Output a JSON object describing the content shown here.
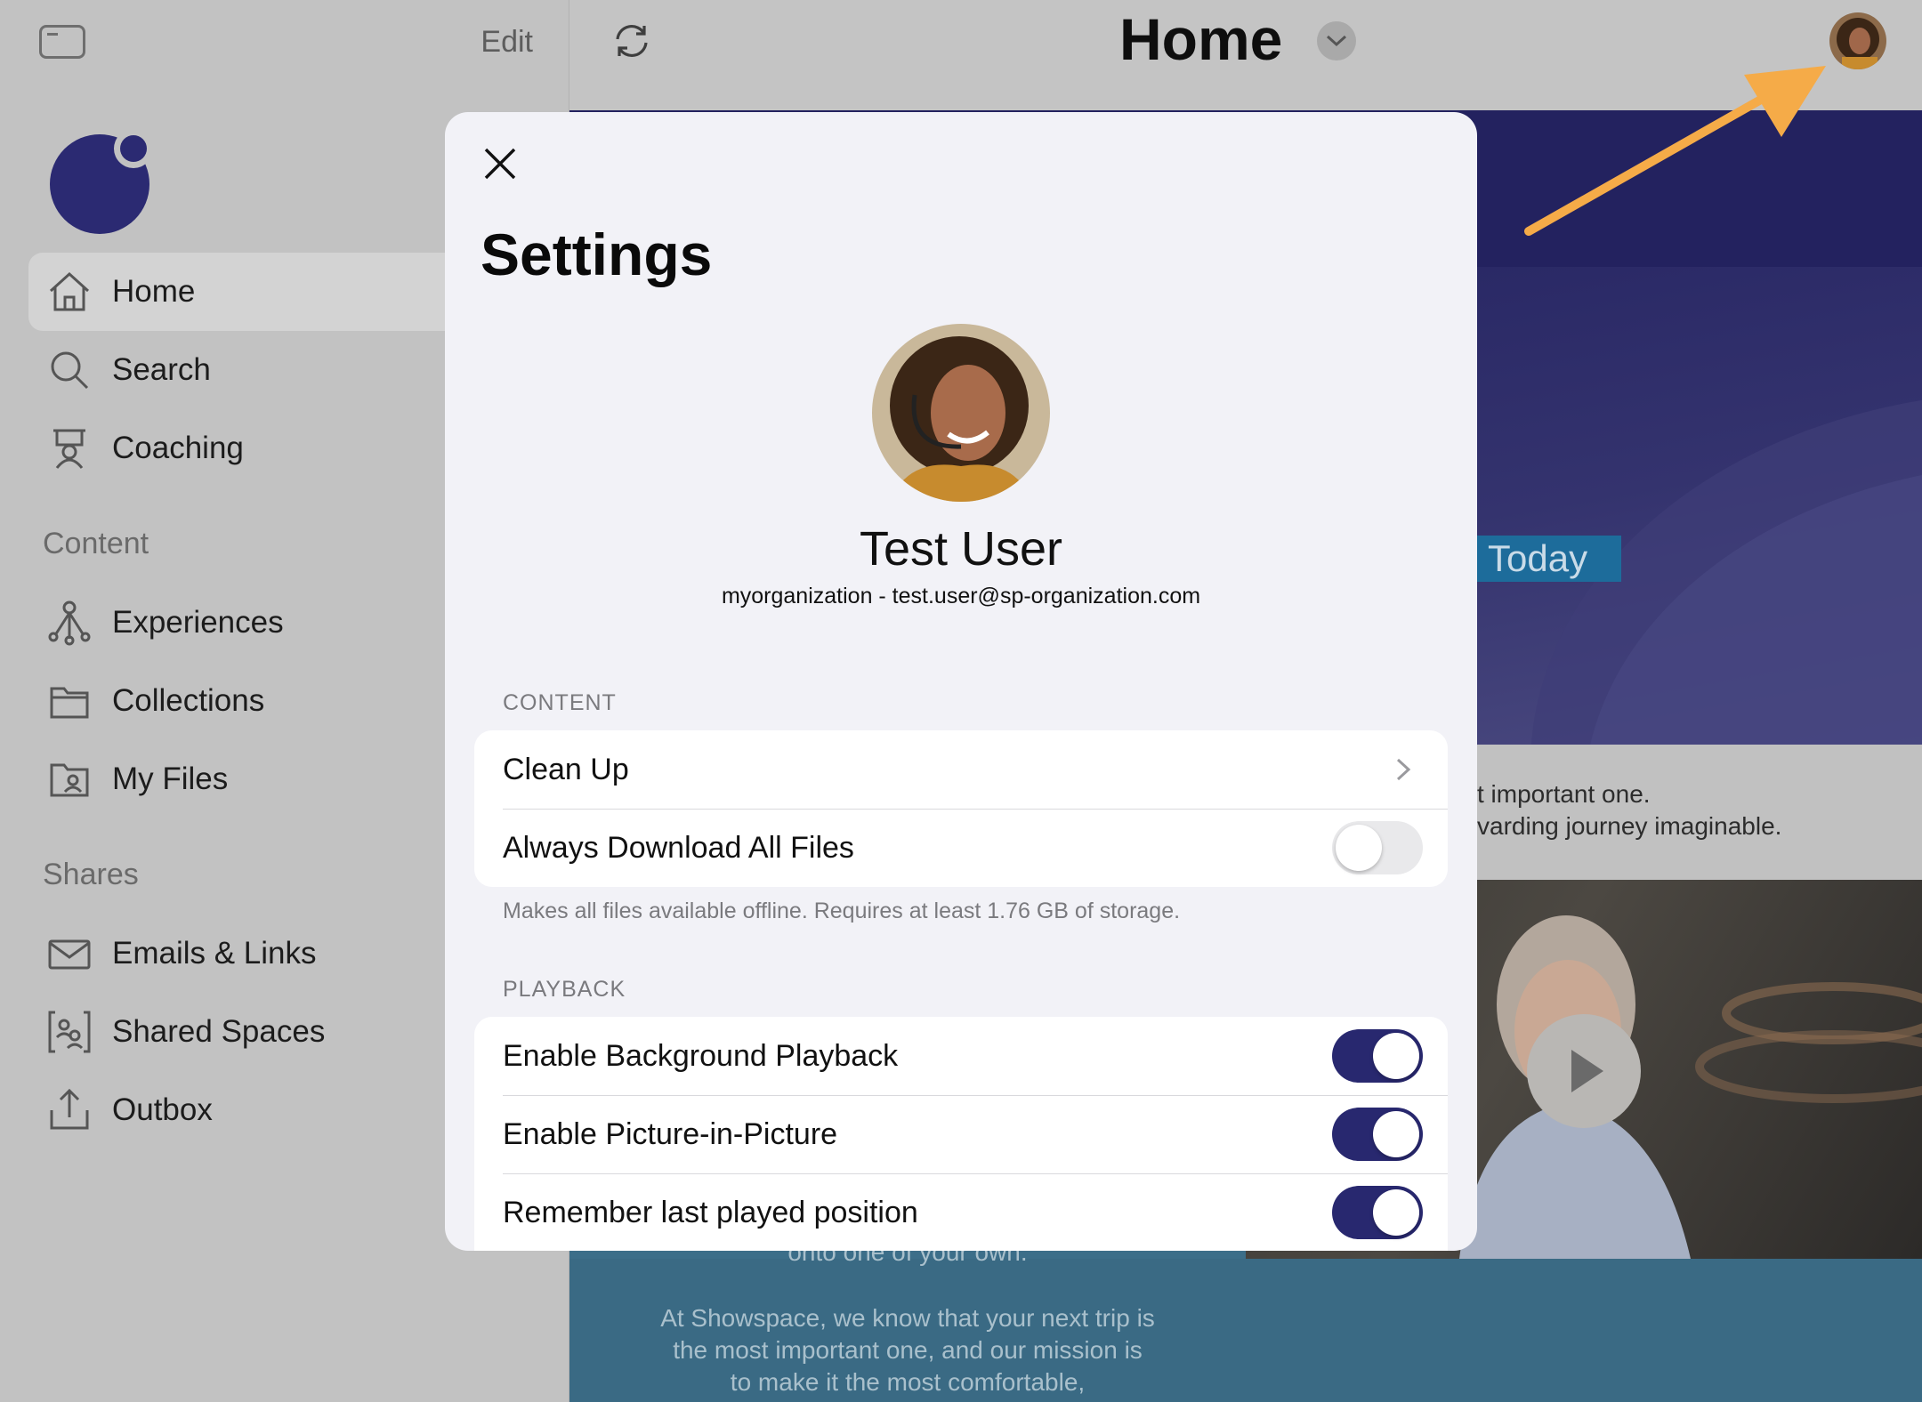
{
  "sidebar": {
    "edit_label": "Edit",
    "nav": [
      {
        "label": "Home",
        "icon": "home-icon",
        "active": true
      },
      {
        "label": "Search",
        "icon": "search-icon"
      },
      {
        "label": "Coaching",
        "icon": "coaching-icon"
      }
    ],
    "content_header": "Content",
    "content_items": [
      {
        "label": "Experiences",
        "icon": "experiences-icon"
      },
      {
        "label": "Collections",
        "icon": "folder-icon"
      },
      {
        "label": "My Files",
        "icon": "my-files-icon"
      }
    ],
    "shares_header": "Shares",
    "shares_items": [
      {
        "label": "Emails & Links",
        "icon": "envelope-icon"
      },
      {
        "label": "Shared Spaces",
        "icon": "shared-spaces-icon"
      },
      {
        "label": "Outbox",
        "icon": "outbox-icon"
      }
    ]
  },
  "topbar": {
    "title": "Home"
  },
  "background": {
    "tag": "Today",
    "text_line1": "t important one.",
    "text_line2": "varding journey imaginable.",
    "ocean_line0": "onto one of your own.",
    "ocean_line1": "At Showspace, we know that your next trip is",
    "ocean_line2": "the most important one, and our mission is",
    "ocean_line3": "to make it the most comfortable,"
  },
  "settings": {
    "title": "Settings",
    "user_name": "Test User",
    "user_email": "myorganization - test.user@sp-organization.com",
    "content_header": "CONTENT",
    "clean_up": "Clean Up",
    "always_download": "Always Download All Files",
    "always_download_on": false,
    "content_footnote": "Makes all files available offline. Requires at least 1.76 GB of storage.",
    "playback_header": "PLAYBACK",
    "background_playback": "Enable Background Playback",
    "background_playback_on": true,
    "pip": "Enable Picture-in-Picture",
    "pip_on": true,
    "remember_position": "Remember last played position",
    "remember_position_on": true
  },
  "colors": {
    "accent": "#28286f",
    "arrow": "#f5ab48",
    "logo": "#2b2a72"
  }
}
